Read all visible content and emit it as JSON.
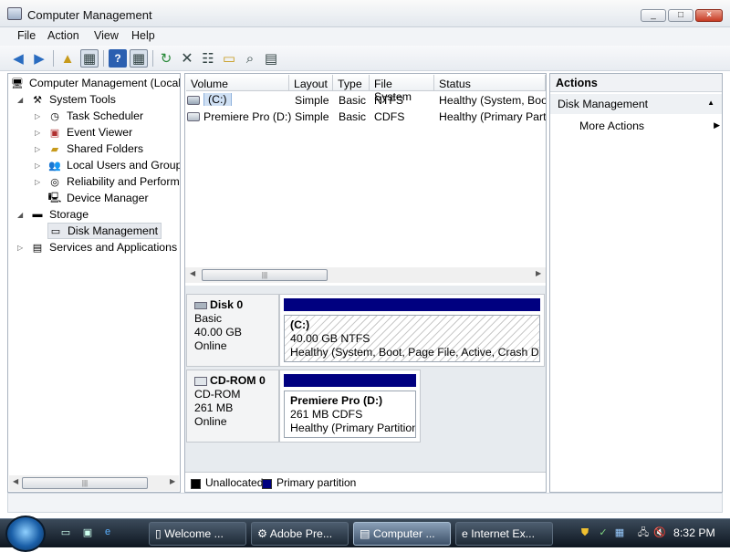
{
  "window": {
    "title": "Computer Management",
    "min": "_",
    "max": "□",
    "close": "×"
  },
  "menu": [
    "File",
    "Action",
    "View",
    "Help"
  ],
  "tree": {
    "root": "Computer Management (Local",
    "system_tools": "System Tools",
    "task_scheduler": "Task Scheduler",
    "event_viewer": "Event Viewer",
    "shared_folders": "Shared Folders",
    "local_users": "Local Users and Groups",
    "reliability": "Reliability and Performa",
    "device_manager": "Device Manager",
    "storage": "Storage",
    "disk_management": "Disk Management",
    "services": "Services and Applications"
  },
  "volumes": {
    "columns": [
      "Volume",
      "Layout",
      "Type",
      "File System",
      "Status"
    ],
    "rows": [
      {
        "volume": "(C:)",
        "layout": "Simple",
        "type": "Basic",
        "fs": "NTFS",
        "status": "Healthy (System, Boot"
      },
      {
        "volume": "Premiere Pro (D:)",
        "layout": "Simple",
        "type": "Basic",
        "fs": "CDFS",
        "status": "Healthy (Primary Parti"
      }
    ]
  },
  "disks": [
    {
      "name": "Disk 0",
      "kind": "Basic",
      "size": "40.00 GB",
      "state": "Online",
      "part_title": "(C:)",
      "part_size": "40.00 GB NTFS",
      "part_status": "Healthy (System, Boot, Page File, Active, Crash Dum"
    },
    {
      "name": "CD-ROM 0",
      "kind": "CD-ROM",
      "size": "261 MB",
      "state": "Online",
      "part_title": "Premiere Pro  (D:)",
      "part_size": "261 MB CDFS",
      "part_status": "Healthy (Primary Partition"
    }
  ],
  "legend": {
    "unallocated": "Unallocated",
    "primary": "Primary partition"
  },
  "actions": {
    "header": "Actions",
    "section": "Disk Management",
    "more": "More Actions"
  },
  "taskbar": {
    "buttons": [
      "Welcome ...",
      "Adobe Pre...",
      "Computer ...",
      "Internet Ex..."
    ],
    "clock": "8:32 PM"
  },
  "colors": {
    "primary_partition": "#000080",
    "unallocated": "#000000"
  }
}
